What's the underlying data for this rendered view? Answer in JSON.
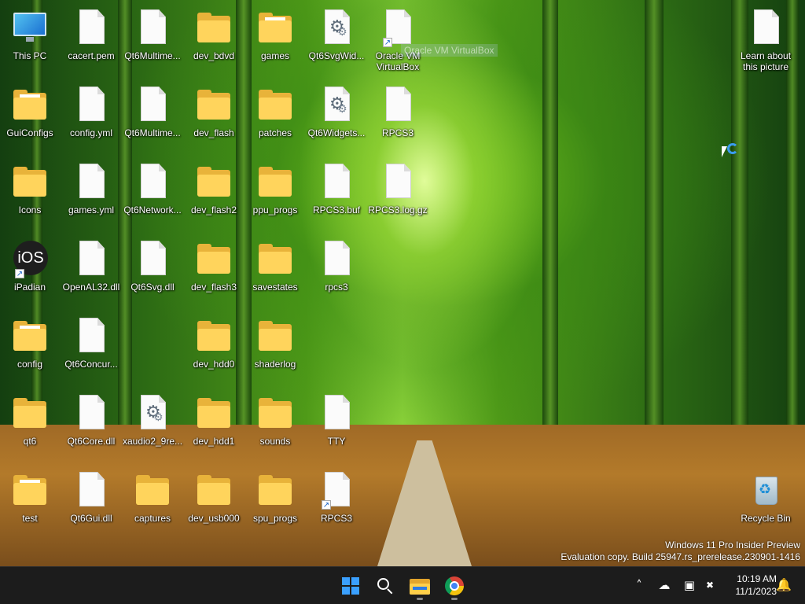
{
  "desktop": {
    "icons": [
      {
        "label": "This PC",
        "kind": "computer"
      },
      {
        "label": "cacert.pem",
        "kind": "file"
      },
      {
        "label": "Qt6Multime...",
        "kind": "file"
      },
      {
        "label": "dev_bdvd",
        "kind": "folder"
      },
      {
        "label": "games",
        "kind": "folder-doc"
      },
      {
        "label": "Qt6SvgWid...",
        "kind": "settings-file"
      },
      {
        "label": "Oracle VM\nVirtualBox",
        "kind": "shortcut-file"
      },
      {
        "label": "Learn about\nthis picture",
        "kind": "file"
      },
      {
        "label": "GuiConfigs",
        "kind": "folder-doc"
      },
      {
        "label": "config.yml",
        "kind": "file"
      },
      {
        "label": "Qt6Multime...",
        "kind": "file"
      },
      {
        "label": "dev_flash",
        "kind": "folder"
      },
      {
        "label": "patches",
        "kind": "folder"
      },
      {
        "label": "Qt6Widgets...",
        "kind": "settings-file"
      },
      {
        "label": "RPCS3",
        "kind": "file"
      },
      {
        "label": "Icons",
        "kind": "folder"
      },
      {
        "label": "games.yml",
        "kind": "file"
      },
      {
        "label": "Qt6Network...",
        "kind": "file"
      },
      {
        "label": "dev_flash2",
        "kind": "folder"
      },
      {
        "label": "ppu_progs",
        "kind": "folder"
      },
      {
        "label": "RPCS3.buf",
        "kind": "file"
      },
      {
        "label": "RPCS3.log.gz",
        "kind": "file"
      },
      {
        "label": "iPadian",
        "kind": "ios-shortcut"
      },
      {
        "label": "OpenAL32.dll",
        "kind": "file"
      },
      {
        "label": "Qt6Svg.dll",
        "kind": "file"
      },
      {
        "label": "dev_flash3",
        "kind": "folder"
      },
      {
        "label": "savestates",
        "kind": "folder"
      },
      {
        "label": "rpcs3",
        "kind": "file"
      },
      {
        "label": "config",
        "kind": "folder-doc"
      },
      {
        "label": "Qt6Concur...",
        "kind": "file"
      },
      {
        "label": "dev_hdd0",
        "kind": "folder"
      },
      {
        "label": "shaderlog",
        "kind": "folder"
      },
      {
        "label": "qt6",
        "kind": "folder"
      },
      {
        "label": "Qt6Core.dll",
        "kind": "file"
      },
      {
        "label": "xaudio2_9re...",
        "kind": "settings-file"
      },
      {
        "label": "dev_hdd1",
        "kind": "folder"
      },
      {
        "label": "sounds",
        "kind": "folder"
      },
      {
        "label": "TTY",
        "kind": "file"
      },
      {
        "label": "test",
        "kind": "folder-doc"
      },
      {
        "label": "Qt6Gui.dll",
        "kind": "file"
      },
      {
        "label": "captures",
        "kind": "folder"
      },
      {
        "label": "dev_usb000",
        "kind": "folder"
      },
      {
        "label": "spu_progs",
        "kind": "folder"
      },
      {
        "label": "RPCS3",
        "kind": "shortcut-file"
      },
      {
        "label": "Recycle Bin",
        "kind": "recycle-bin"
      }
    ],
    "drag_ghost_text": "Oracle VM VirtualBox",
    "watermark": {
      "line1": "Windows 11 Pro Insider Preview",
      "line2": "Evaluation copy. Build 25947.rs_prerelease.230901-1416"
    }
  },
  "taskbar": {
    "clock_time": "10:19 AM",
    "clock_date": "11/1/2023",
    "pinned": [
      {
        "name": "start-button",
        "icon": "windows-logo-icon"
      },
      {
        "name": "search-button",
        "icon": "search-icon"
      },
      {
        "name": "file-explorer-button",
        "icon": "folder-icon"
      },
      {
        "name": "chrome-button",
        "icon": "chrome-icon"
      }
    ],
    "tray": [
      {
        "name": "show-hidden-icons-button",
        "icon": "chevron-up-icon",
        "glyph": "˄"
      },
      {
        "name": "onedrive-button",
        "icon": "cloud-off-icon",
        "glyph": "☁"
      },
      {
        "name": "network-button",
        "icon": "network-icon",
        "glyph": "▣"
      },
      {
        "name": "volume-button",
        "icon": "volume-muted-icon",
        "glyph": "✖"
      }
    ],
    "accent": "#3aa0ff"
  }
}
